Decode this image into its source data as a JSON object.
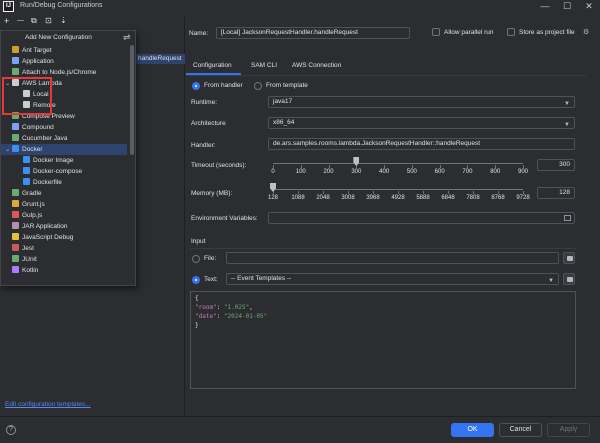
{
  "window": {
    "title": "Run/Debug Configurations",
    "logo": "IJ",
    "min": "—",
    "max": "☐",
    "close": "✕"
  },
  "toolbar": {
    "add": "+",
    "remove": "—",
    "copy": "⧉",
    "save": "⊡",
    "more": "⇣"
  },
  "popup": {
    "title": "Add New Configuration",
    "filter_icon": "filter-icon",
    "items": [
      {
        "label": "Ant Target",
        "icon": "ant-icon",
        "color": "#c9a227",
        "indent": 0
      },
      {
        "label": "Application",
        "icon": "application-icon",
        "color": "#7aa2f7",
        "indent": 0
      },
      {
        "label": "Attach to Node.js/Chrome",
        "icon": "node-icon",
        "color": "#6aab73",
        "indent": 0
      },
      {
        "label": "AWS Lambda",
        "icon": "lambda-icon",
        "color": "#c9ccd1",
        "indent": 0,
        "expanded": true
      },
      {
        "label": "Local",
        "icon": "lambda-icon",
        "color": "#c9ccd1",
        "indent": 1
      },
      {
        "label": "Remote",
        "icon": "lambda-icon",
        "color": "#c9ccd1",
        "indent": 1
      },
      {
        "label": "Compose Preview",
        "icon": "compose-icon",
        "color": "#6aab73",
        "indent": 0
      },
      {
        "label": "Compound",
        "icon": "compound-icon",
        "color": "#7aa2f7",
        "indent": 0
      },
      {
        "label": "Cucumber Java",
        "icon": "cucumber-icon",
        "color": "#6aab73",
        "indent": 0
      },
      {
        "label": "Docker",
        "icon": "docker-icon",
        "color": "#3d8ff5",
        "indent": 0,
        "expanded": true,
        "selected": true
      },
      {
        "label": "Docker Image",
        "icon": "docker-icon",
        "color": "#3d8ff5",
        "indent": 1
      },
      {
        "label": "Docker-compose",
        "icon": "docker-icon",
        "color": "#3d8ff5",
        "indent": 1
      },
      {
        "label": "Dockerfile",
        "icon": "docker-icon",
        "color": "#3d8ff5",
        "indent": 1
      },
      {
        "label": "Gradle",
        "icon": "gradle-icon",
        "color": "#6aab73",
        "indent": 0
      },
      {
        "label": "Grunt.js",
        "icon": "grunt-icon",
        "color": "#e0a93a",
        "indent": 0
      },
      {
        "label": "Gulp.js",
        "icon": "gulp-icon",
        "color": "#e05555",
        "indent": 0
      },
      {
        "label": "JAR Application",
        "icon": "jar-icon",
        "color": "#b48ead",
        "indent": 0
      },
      {
        "label": "JavaScript Debug",
        "icon": "js-debug-icon",
        "color": "#e0c33a",
        "indent": 0
      },
      {
        "label": "Jest",
        "icon": "jest-icon",
        "color": "#c75c5c",
        "indent": 0
      },
      {
        "label": "JUnit",
        "icon": "junit-icon",
        "color": "#6aab73",
        "indent": 0
      },
      {
        "label": "Kotlin",
        "icon": "kotlin-icon",
        "color": "#a97bff",
        "indent": 0
      }
    ]
  },
  "peek_item": "handleRequest",
  "edit_templates": "Edit configuration templates...",
  "form": {
    "name_label": "Name:",
    "name_value": "[Local] JacksonRequestHandler.handleRequest",
    "allow_parallel": "Allow parallel run",
    "store_project": "Store as project file",
    "tabs": [
      "Configuration",
      "SAM CLI",
      "AWS Connection"
    ],
    "from_handler": "From handler",
    "from_template": "From template",
    "runtime_label": "Runtime:",
    "runtime_value": "java17",
    "arch_label": "Architecture",
    "arch_value": "x86_64",
    "handler_label": "Handler:",
    "handler_value": "de.ars.samples.rooms.lambda.JacksonRequestHandler::handleRequest",
    "timeout_label": "Timeout (seconds):",
    "timeout_value": "300",
    "timeout_ticks": [
      "0",
      "100",
      "200",
      "300",
      "400",
      "500",
      "600",
      "700",
      "800",
      "900"
    ],
    "timeout_level": 300,
    "timeout_max": 900,
    "memory_label": "Memory (MB):",
    "memory_value": "128",
    "memory_ticks": [
      "128",
      "1088",
      "2048",
      "3008",
      "3968",
      "4928",
      "5888",
      "6848",
      "7808",
      "8768",
      "9728"
    ],
    "memory_level": 128,
    "memory_min": 128,
    "memory_max": 10240,
    "env_label": "Environment Variables:",
    "input_label": "Input",
    "file_label": "File:",
    "text_label": "Text:",
    "event_templates": "-- Event Templates --",
    "editor_lines": [
      "{",
      "  \"room\": \"1.025\",",
      "  \"date\": \"2024-01-05\"",
      "}"
    ]
  },
  "buttons": {
    "ok": "OK",
    "cancel": "Cancel",
    "apply": "Apply"
  },
  "colors": {
    "accent": "#3574f0",
    "highlight": "#e53935",
    "link": "#548af7"
  }
}
